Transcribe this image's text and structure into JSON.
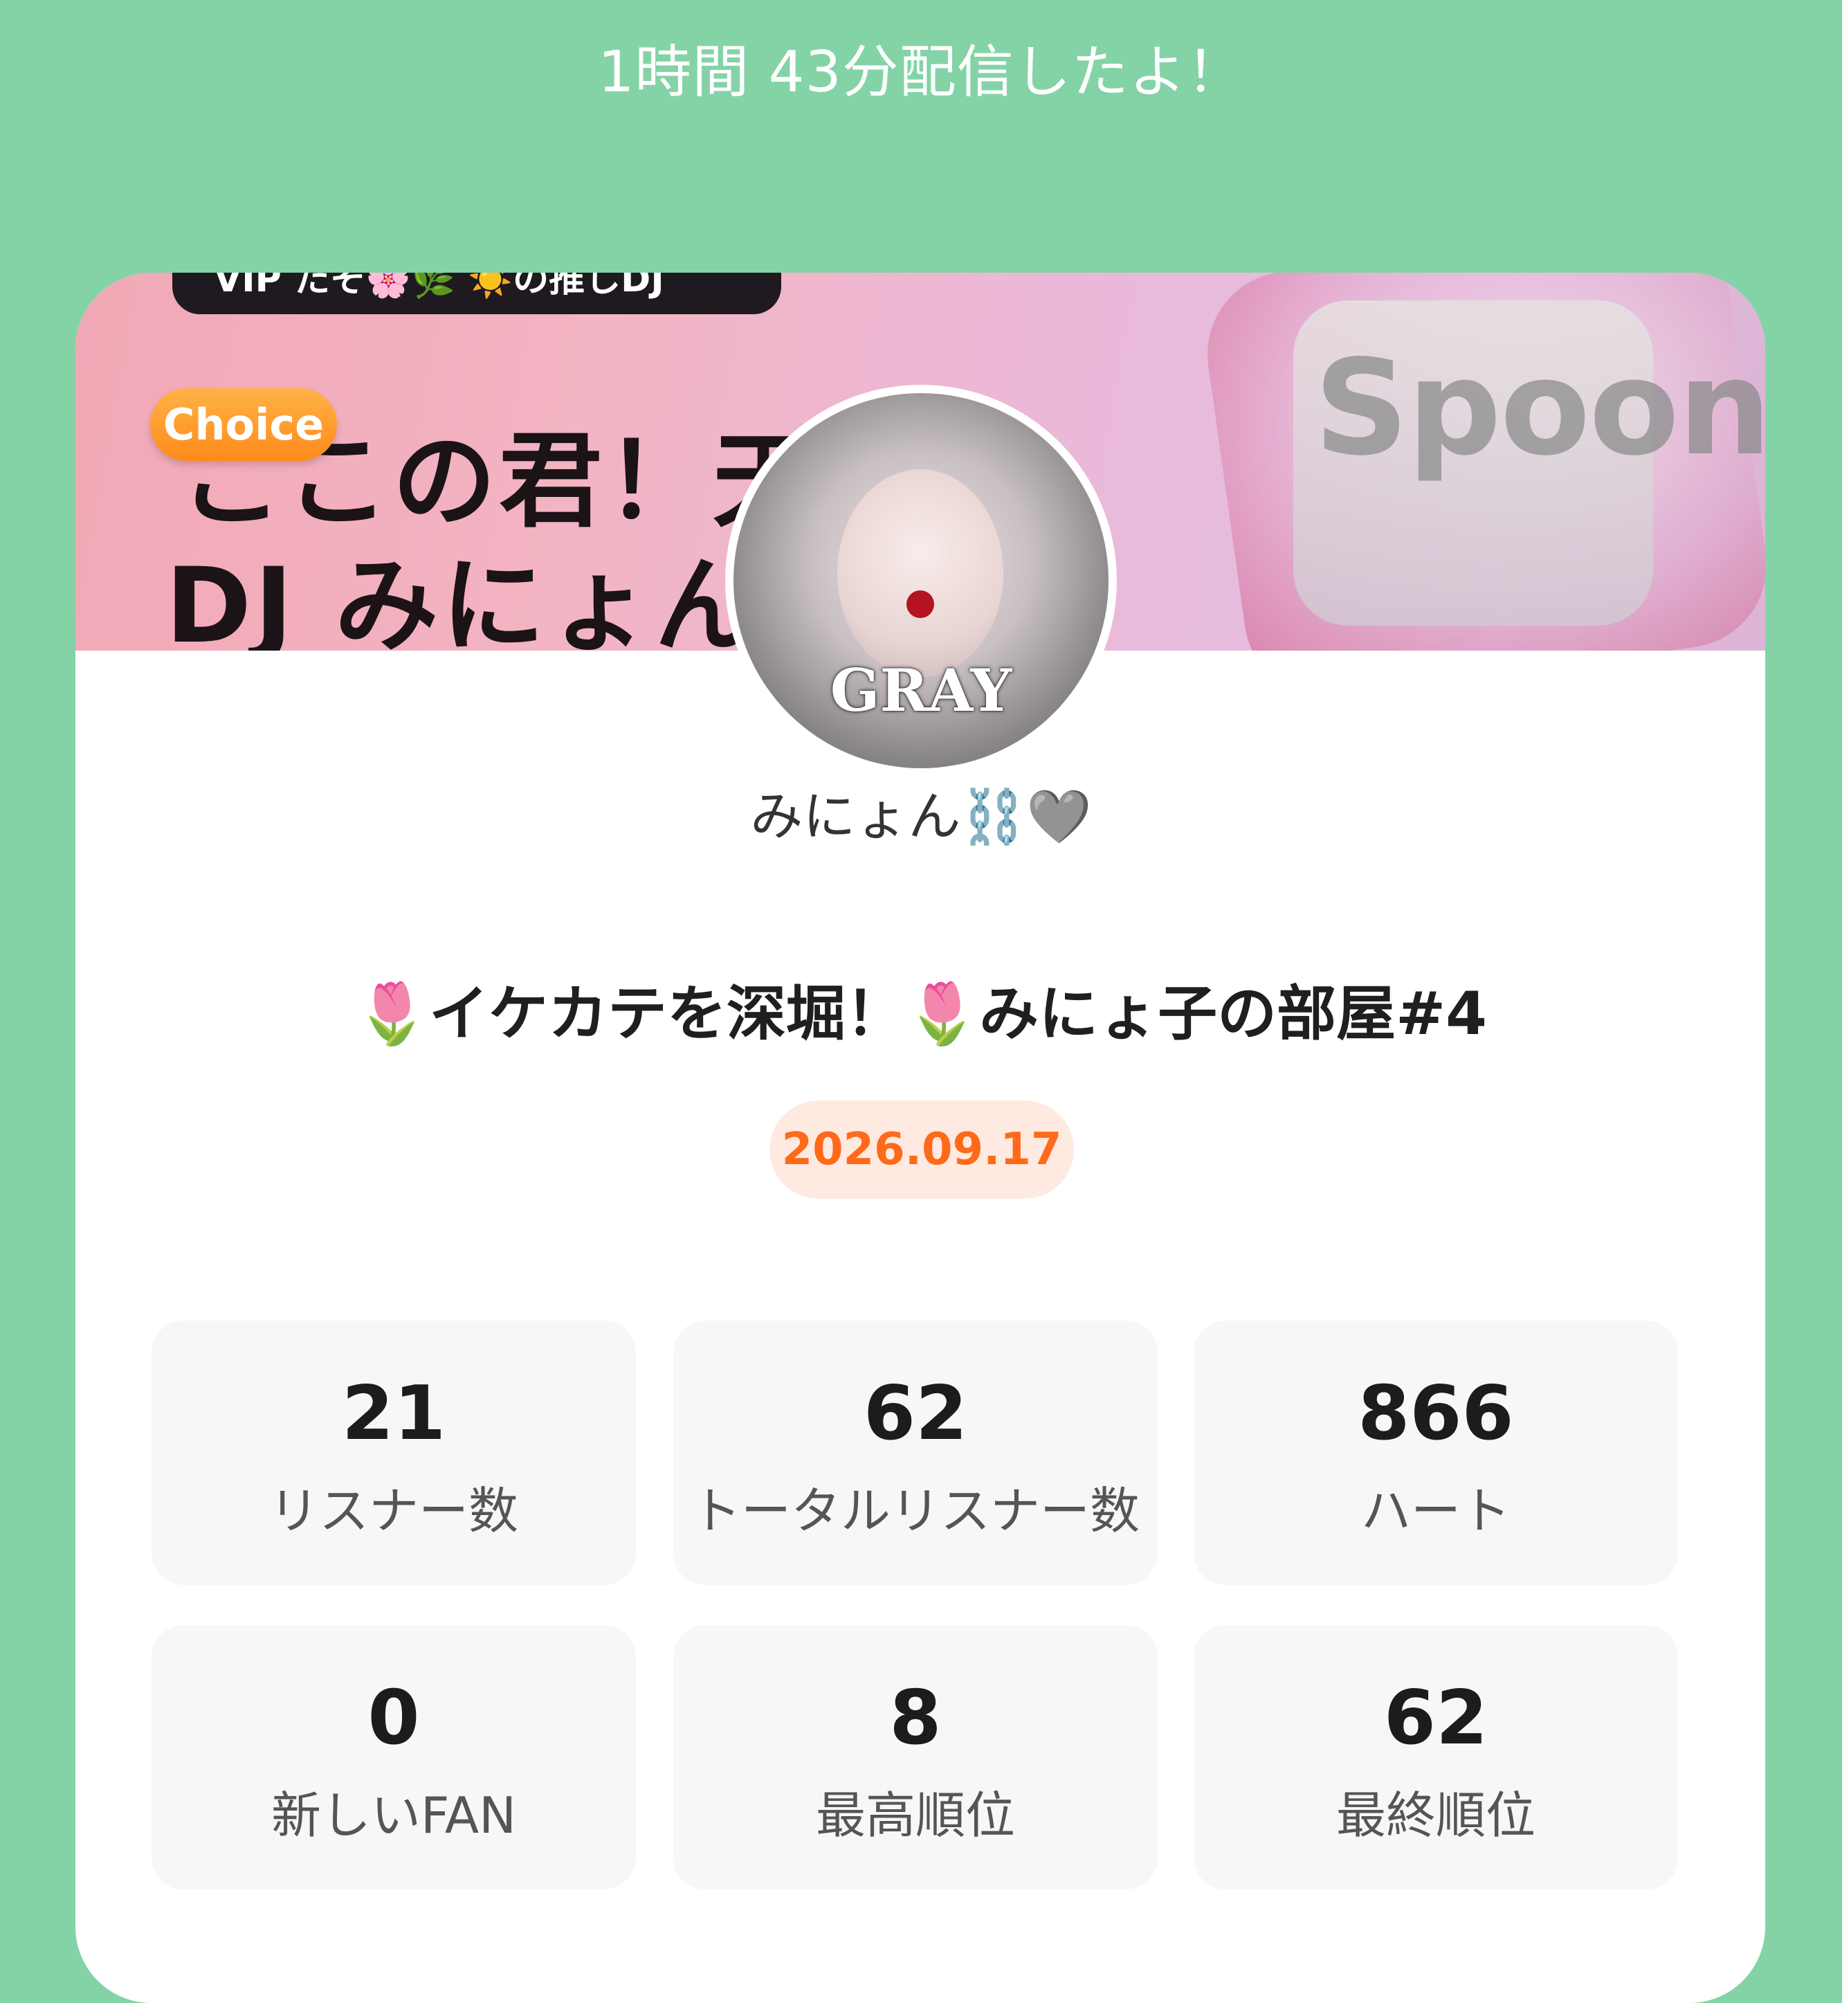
{
  "header": {
    "summary": "1時間 43分配信したよ！"
  },
  "banner": {
    "top_bar_text": "VIP たそ🌸🌿 ☀️の推しDJ",
    "title_line_1": "ここの君！天才",
    "title_line_2": "DJ みにょん",
    "choice_badge": "Choice",
    "logo": "Spoon"
  },
  "profile": {
    "avatar_label": "GRAY",
    "dj_name": "みにょん⛓️🩶"
  },
  "live": {
    "title": "🌷イケカテを深堀！🌷みにょ子の部屋#4",
    "date": "2026.09.17"
  },
  "stats": [
    {
      "value": "21",
      "label": "リスナー数"
    },
    {
      "value": "62",
      "label": "トータルリスナー数"
    },
    {
      "value": "866",
      "label": "ハート"
    },
    {
      "value": "0",
      "label": "新しいFAN"
    },
    {
      "value": "8",
      "label": "最高順位"
    },
    {
      "value": "62",
      "label": "最終順位"
    }
  ],
  "colors": {
    "background": "#83d3a7",
    "accent": "#ff6a1a",
    "date_pill_bg": "#ffeae2",
    "choice_badge": "#ff8a1c"
  }
}
